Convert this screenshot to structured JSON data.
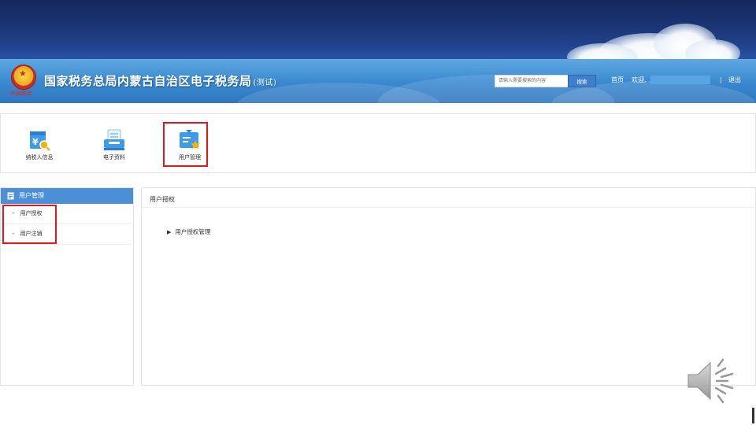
{
  "header": {
    "title": "国家税务总局内蒙古自治区电子税务局",
    "title_suffix": "(测试)",
    "emblem_signature": "中国税务",
    "search": {
      "placeholder": "请输入需要搜索的内容",
      "button_label": "搜索"
    },
    "nav": {
      "home": "首页",
      "welcome": "欢迎,",
      "separator": "|",
      "logout": "退出"
    }
  },
  "apps": [
    {
      "label": "纳税人信息",
      "icon": "taxpayer-info-icon"
    },
    {
      "label": "电子资料",
      "icon": "electronic-docs-icon"
    },
    {
      "label": "用户管理",
      "icon": "user-management-icon",
      "highlighted": true
    }
  ],
  "sidebar": {
    "title": "用户管理",
    "items": [
      {
        "label": "用户授权"
      },
      {
        "label": "用户注销"
      }
    ]
  },
  "main": {
    "panel_title": "用户授权",
    "tree": [
      {
        "label": "用户授权管理",
        "expanded": false
      }
    ]
  },
  "colors": {
    "top_band": "#1a3575",
    "header_blue": "#3c8ad1",
    "search_button": "#3f7fcb",
    "sidebar_header": "#4a8fd8",
    "highlight_red": "#e0181b"
  }
}
